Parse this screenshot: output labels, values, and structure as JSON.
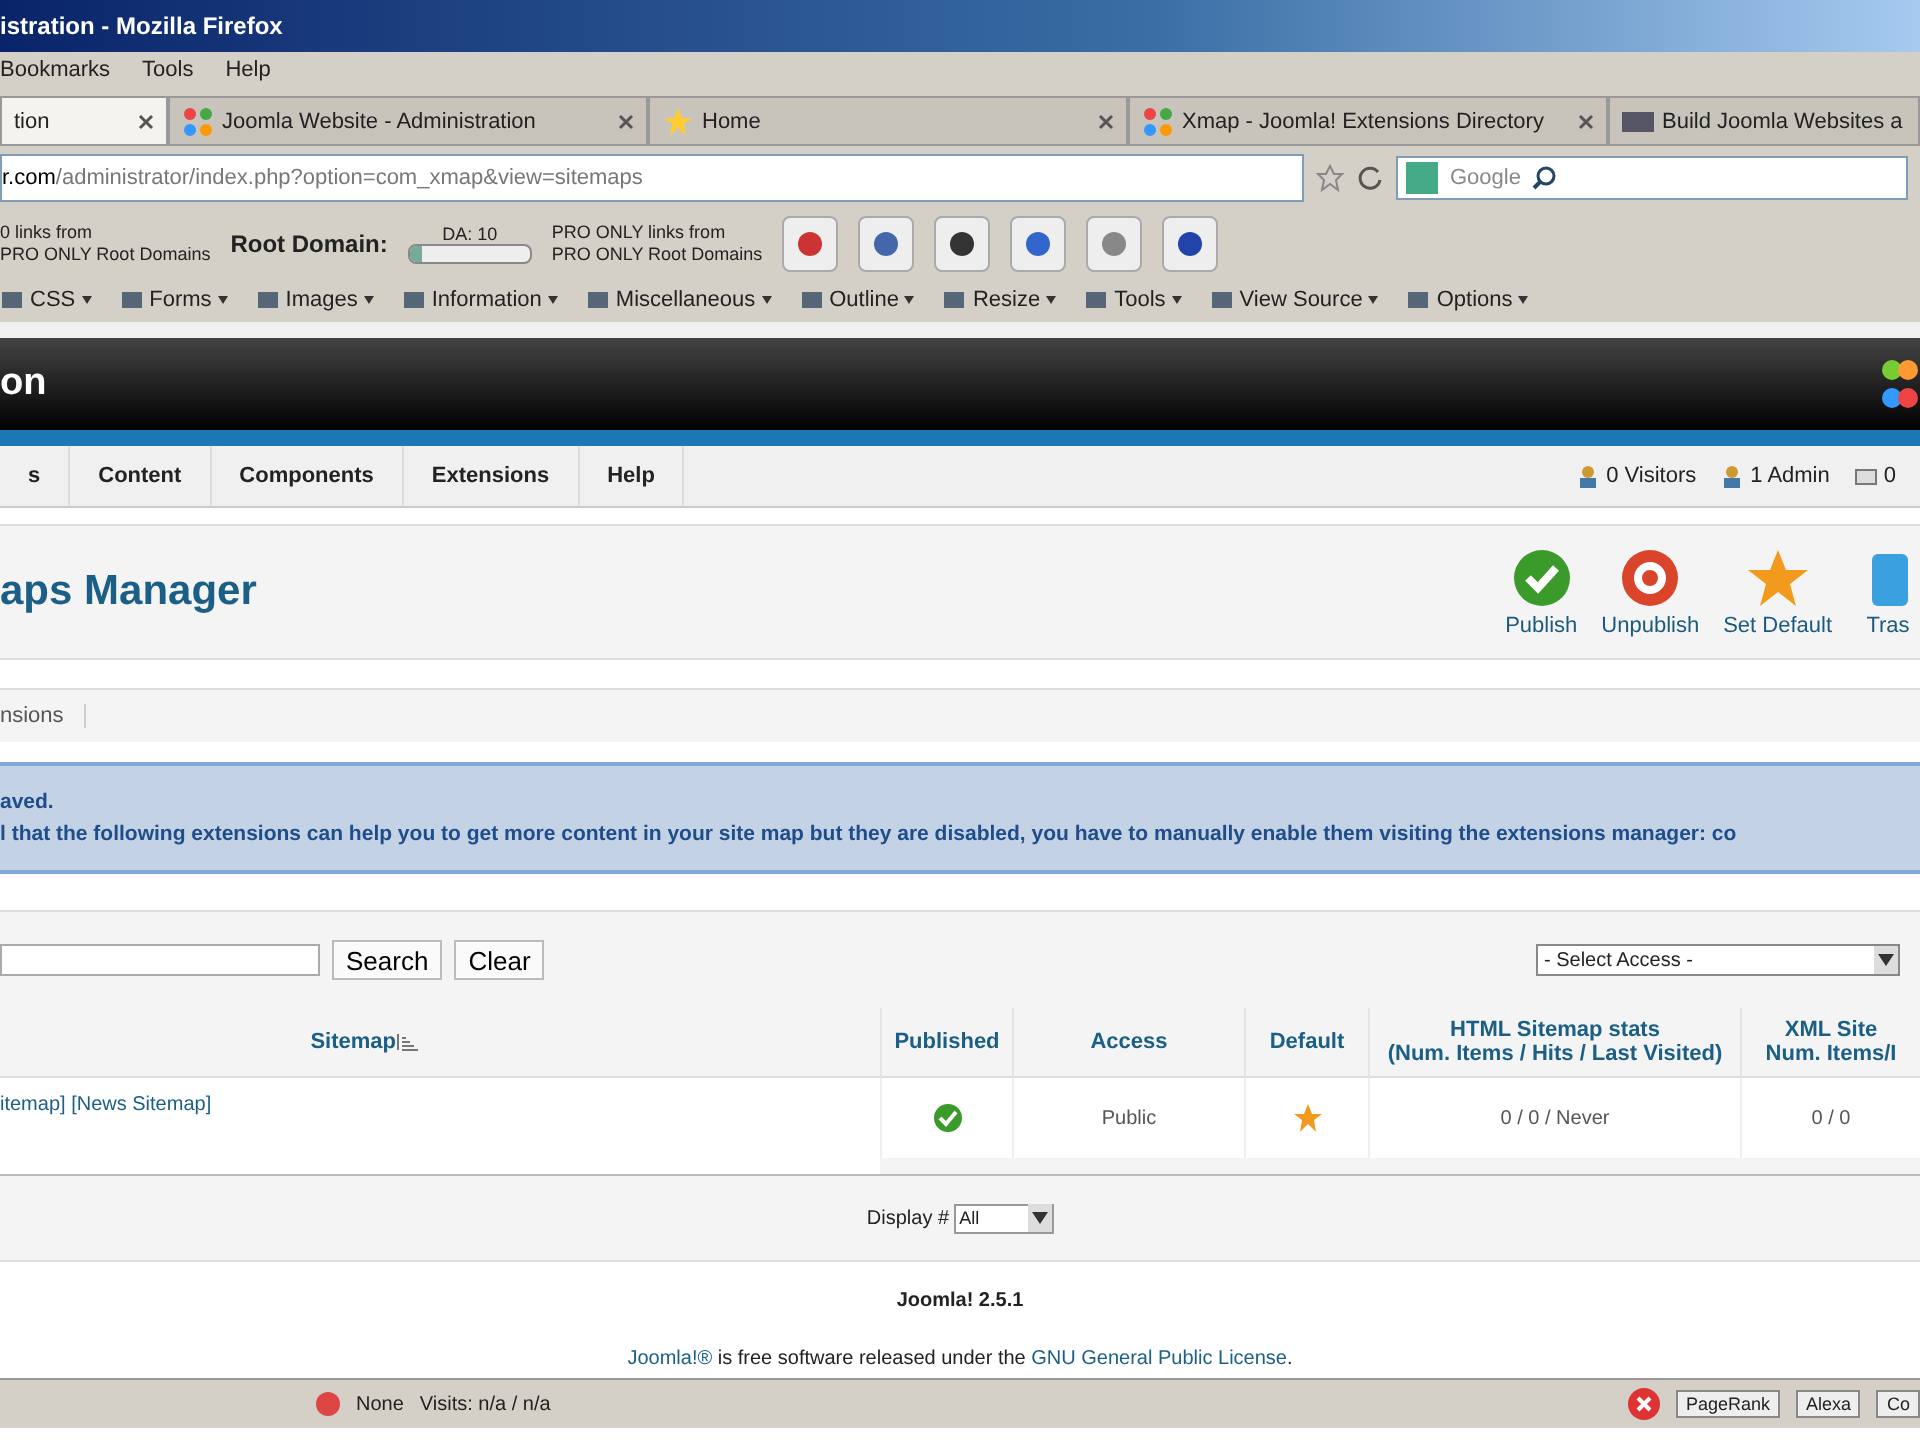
{
  "window": {
    "title": "istration - Mozilla Firefox"
  },
  "menu_bar": [
    "Bookmarks",
    "Tools",
    "Help"
  ],
  "tabs": [
    {
      "label": "tion",
      "selected": true,
      "kind": "plain"
    },
    {
      "label": "Joomla Website - Administration",
      "selected": false,
      "kind": "joomla"
    },
    {
      "label": "Home",
      "selected": false,
      "kind": "star"
    },
    {
      "label": "Xmap - Joomla! Extensions Directory",
      "selected": false,
      "kind": "joomla"
    },
    {
      "label": "Build Joomla Websites a",
      "selected": false,
      "kind": "cms"
    }
  ],
  "address_bar": {
    "host": "r.com",
    "path": "/administrator/index.php?option=com_xmap&view=sitemaps"
  },
  "search_box": {
    "placeholder": "Google"
  },
  "seo_toolbar": {
    "links_text": "0 links from\nPRO ONLY Root Domains",
    "root_domain_label": "Root Domain:",
    "da_label": "DA: 10",
    "level": 0.1,
    "pro_text": "PRO ONLY links from\nPRO ONLY Root Domains"
  },
  "developer_toolbar": [
    "CSS",
    "Forms",
    "Images",
    "Information",
    "Miscellaneous",
    "Outline",
    "Resize",
    "Tools",
    "View Source",
    "Options"
  ],
  "admin_header": {
    "title": "on"
  },
  "admin_menu": [
    {
      "label": "s"
    },
    {
      "label": "Content"
    },
    {
      "label": "Components"
    },
    {
      "label": "Extensions"
    },
    {
      "label": "Help"
    }
  ],
  "admin_status": [
    "0 Visitors",
    "1 Admin",
    "0"
  ],
  "page_title": "aps Manager",
  "toolbar_buttons": [
    {
      "label": "Publish",
      "kind": "publish"
    },
    {
      "label": "Unpublish",
      "kind": "unpublish"
    },
    {
      "label": "Set Default",
      "kind": "default"
    },
    {
      "label": "Tras",
      "kind": "trash"
    }
  ],
  "submenu": [
    "nsions"
  ],
  "message": [
    "aved.",
    "l that the following extensions can help you to get more content in your site map but they are disabled, you have to manually enable them visiting the extensions manager: co"
  ],
  "filter": {
    "search_button": "Search",
    "clear_button": "Clear",
    "access_select": "- Select Access -"
  },
  "table": {
    "columns": [
      "Sitemap",
      "Published",
      "Access",
      "Default",
      "HTML Sitemap stats\n(Num. Items / Hits / Last Visited)",
      "XML Site\nNum. Items/I"
    ],
    "rows": [
      {
        "sitemap": "itemap] [News Sitemap]",
        "published": true,
        "access": "Public",
        "default": true,
        "html_stats": "0 / 0 / Never",
        "xml_stats": "0 / 0"
      }
    ]
  },
  "pagination": {
    "label": "Display #",
    "value": "All"
  },
  "footer": {
    "version": "Joomla! 2.5.1",
    "license_link": "Joomla!®",
    "license_text": " is free software released under the ",
    "gpl_link": "GNU General Public License",
    "end": "."
  },
  "status_bar": {
    "none_label": "None",
    "visits": "Visits: n/a / n/a",
    "pagerank": "PageRank",
    "alexa": "Alexa",
    "cut": "Co"
  }
}
